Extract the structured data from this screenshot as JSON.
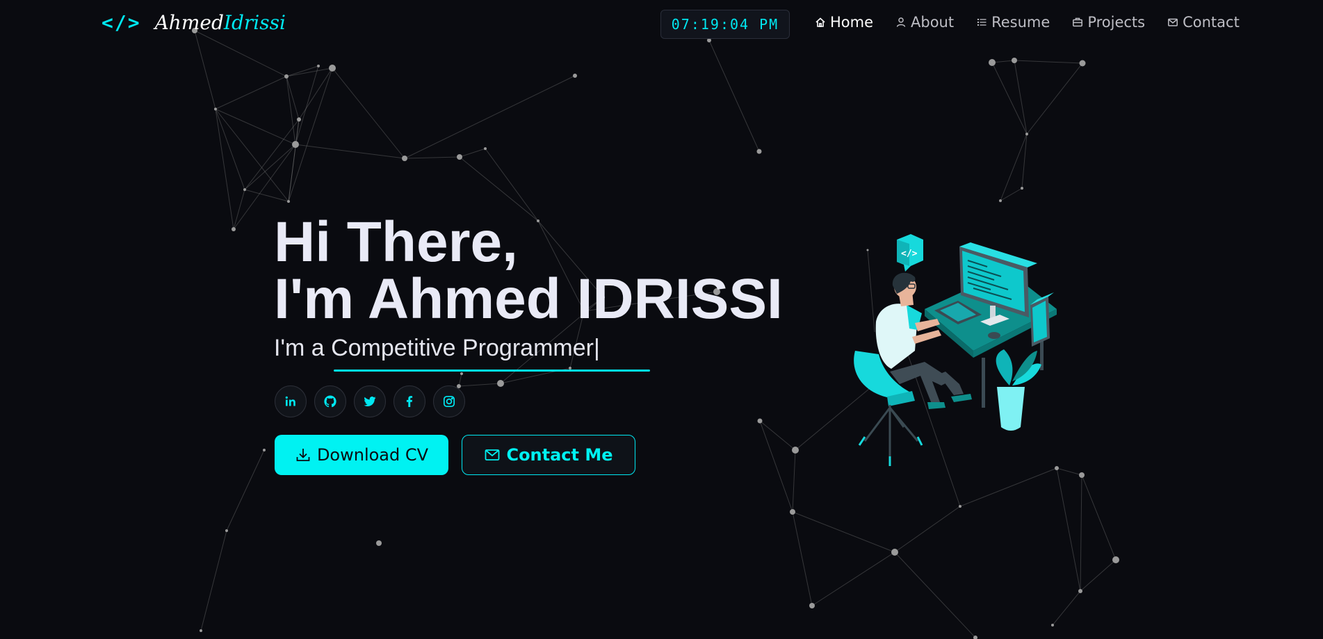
{
  "brand": {
    "mark": "</>",
    "first_name": "Ahmed",
    "last_name": "Idrissi"
  },
  "clock": {
    "time": "07:19:04 PM"
  },
  "nav": {
    "items": [
      {
        "label": "Home",
        "icon": "home-icon",
        "active": true
      },
      {
        "label": "About",
        "icon": "user-icon",
        "active": false
      },
      {
        "label": "Resume",
        "icon": "list-icon",
        "active": false
      },
      {
        "label": "Projects",
        "icon": "briefcase-icon",
        "active": false
      },
      {
        "label": "Contact",
        "icon": "mail-icon",
        "active": false
      }
    ]
  },
  "hero": {
    "greeting": "Hi There,",
    "intro": "I'm Ahmed IDRISSI",
    "role_prefix": "I'm a ",
    "role": "Competitive Programmer|"
  },
  "socials": [
    {
      "name": "linkedin",
      "icon": "linkedin-icon",
      "glyph": "in"
    },
    {
      "name": "github",
      "icon": "github-icon"
    },
    {
      "name": "twitter",
      "icon": "twitter-icon"
    },
    {
      "name": "facebook",
      "icon": "facebook-icon",
      "glyph": "f"
    },
    {
      "name": "instagram",
      "icon": "instagram-icon"
    }
  ],
  "buttons": {
    "download_cv": "Download CV",
    "contact_me": "Contact Me"
  },
  "colors": {
    "accent": "#00f2f2",
    "background": "#0a0b10",
    "text": "#e9eaf6",
    "nav_inactive": "#bdbdc4"
  }
}
